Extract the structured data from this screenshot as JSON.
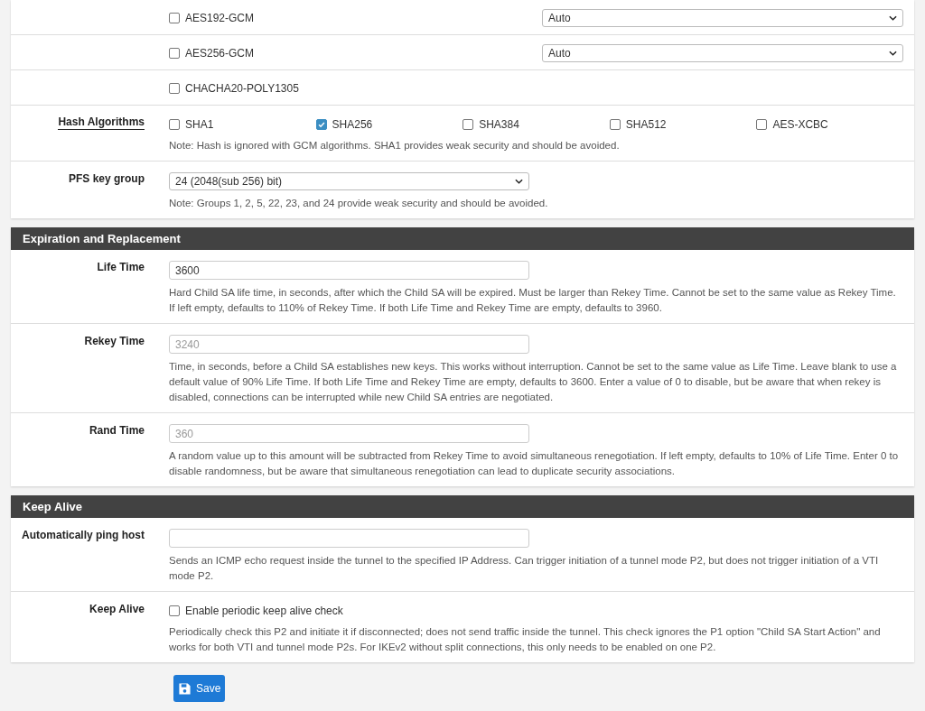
{
  "cipher_rows": [
    {
      "label": "AES192-GCM",
      "checked": false,
      "select": "Auto"
    },
    {
      "label": "AES256-GCM",
      "checked": false,
      "select": "Auto"
    },
    {
      "label": "CHACHA20-POLY1305",
      "checked": false
    }
  ],
  "hash_algorithms": {
    "label": "Hash Algorithms",
    "options": [
      {
        "label": "SHA1",
        "checked": false
      },
      {
        "label": "SHA256",
        "checked": true
      },
      {
        "label": "SHA384",
        "checked": false
      },
      {
        "label": "SHA512",
        "checked": false
      },
      {
        "label": "AES-XCBC",
        "checked": false
      }
    ],
    "note": "Note: Hash is ignored with GCM algorithms. SHA1 provides weak security and should be avoided."
  },
  "pfs_key_group": {
    "label": "PFS key group",
    "value": "24 (2048(sub 256) bit)",
    "note": "Note: Groups 1, 2, 5, 22, 23, and 24 provide weak security and should be avoided."
  },
  "sections": [
    {
      "title": "Expiration and Replacement",
      "rows": [
        {
          "kind": "input",
          "label": "Life Time",
          "value": "3600",
          "help": "Hard Child SA life time, in seconds, after which the Child SA will be expired. Must be larger than Rekey Time. Cannot be set to the same value as Rekey Time. If left empty, defaults to 110% of Rekey Time. If both Life Time and Rekey Time are empty, defaults to 3960."
        },
        {
          "kind": "input",
          "label": "Rekey Time",
          "placeholder": "3240",
          "help": "Time, in seconds, before a Child SA establishes new keys. This works without interruption. Cannot be set to the same value as Life Time. Leave blank to use a default value of 90% Life Time. If both Life Time and Rekey Time are empty, defaults to 3600. Enter a value of 0 to disable, but be aware that when rekey is disabled, connections can be interrupted while new Child SA entries are negotiated."
        },
        {
          "kind": "input",
          "label": "Rand Time",
          "placeholder": "360",
          "help": "A random value up to this amount will be subtracted from Rekey Time to avoid simultaneous renegotiation. If left empty, defaults to 10% of Life Time. Enter 0 to disable randomness, but be aware that simultaneous renegotiation can lead to duplicate security associations."
        }
      ]
    },
    {
      "title": "Keep Alive",
      "rows": [
        {
          "kind": "input",
          "label": "Automatically ping host",
          "help": "Sends an ICMP echo request inside the tunnel to the specified IP Address. Can trigger initiation of a tunnel mode P2, but does not trigger initiation of a VTI mode P2."
        },
        {
          "kind": "checkbox",
          "label": "Keep Alive",
          "checkbox_label": "Enable periodic keep alive check",
          "checked": false,
          "help": "Periodically check this P2 and initiate it if disconnected; does not send traffic inside the tunnel. This check ignores the P1 option \"Child SA Start Action\" and works for both VTI and tunnel mode P2s. For IKEv2 without split connections, this only needs to be enabled on one P2."
        }
      ]
    }
  ],
  "save_button": "Save"
}
